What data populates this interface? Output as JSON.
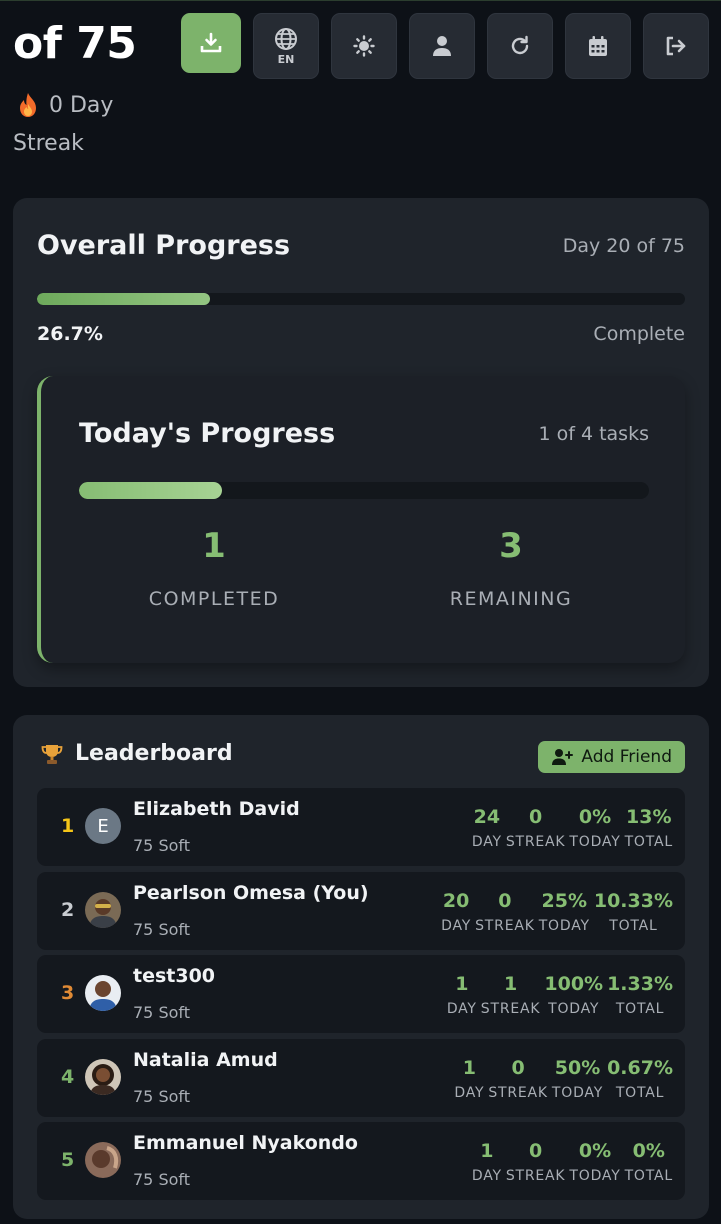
{
  "header": {
    "title": "of 75",
    "streak_value": "0 Day",
    "streak_label": "Streak",
    "language_code": "EN",
    "toolbar": [
      {
        "name": "download-button",
        "icon": "download-icon"
      },
      {
        "name": "language-button",
        "icon": "globe-icon"
      },
      {
        "name": "theme-button",
        "icon": "sun-icon"
      },
      {
        "name": "profile-button",
        "icon": "user-icon"
      },
      {
        "name": "refresh-button",
        "icon": "refresh-icon"
      },
      {
        "name": "calendar-button",
        "icon": "calendar-icon"
      },
      {
        "name": "logout-button",
        "icon": "logout-icon"
      }
    ]
  },
  "overall": {
    "title": "Overall Progress",
    "day_text": "Day 20 of 75",
    "percent_text": "26.7%",
    "percent_value": 26.7,
    "complete_label": "Complete"
  },
  "today": {
    "title": "Today's Progress",
    "tasks_text": "1 of 4 tasks",
    "progress_fraction": 0.25,
    "completed_value": "1",
    "completed_label": "COMPLETED",
    "remaining_value": "3",
    "remaining_label": "REMAINING"
  },
  "leaderboard": {
    "title": "Leaderboard",
    "add_friend_label": "Add Friend",
    "stat_labels": {
      "day": "DAY",
      "streak": "STREAK",
      "today": "TODAY",
      "total": "TOTAL"
    },
    "rows": [
      {
        "rank": "1",
        "rank_color": "#f5c518",
        "avatar_letter": "E",
        "name": "Elizabeth David",
        "plan": "75 Soft",
        "day": "24",
        "streak": "0",
        "today": "0%",
        "total": "13%"
      },
      {
        "rank": "2",
        "rank_color": "#c9ccd1",
        "avatar_letter": "",
        "name": "Pearlson Omesa (You)",
        "plan": "75 Soft",
        "day": "20",
        "streak": "0",
        "today": "25%",
        "total": "10.33%"
      },
      {
        "rank": "3",
        "rank_color": "#e08a35",
        "avatar_letter": "",
        "name": "test300",
        "plan": "75 Soft",
        "day": "1",
        "streak": "1",
        "today": "100%",
        "total": "1.33%"
      },
      {
        "rank": "4",
        "rank_color": "#7db36b",
        "avatar_letter": "",
        "name": "Natalia Amud",
        "plan": "75 Soft",
        "day": "1",
        "streak": "0",
        "today": "50%",
        "total": "0.67%"
      },
      {
        "rank": "5",
        "rank_color": "#7db36b",
        "avatar_letter": "",
        "name": "Emmanuel Nyakondo",
        "plan": "75 Soft",
        "day": "1",
        "streak": "0",
        "today": "0%",
        "total": "0%"
      }
    ]
  }
}
